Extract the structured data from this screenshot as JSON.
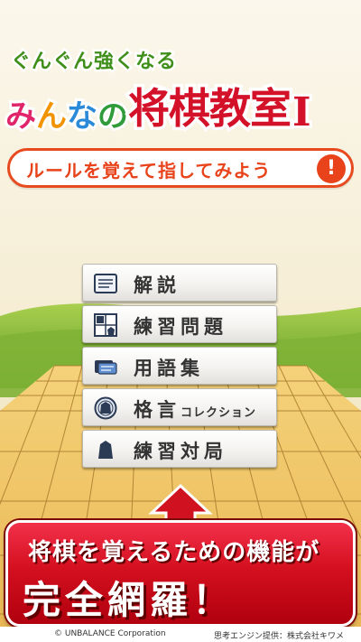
{
  "app": {
    "subtitle": "ぐんぐん強くなる",
    "title_kana": [
      "み",
      "ん",
      "な",
      "の"
    ],
    "title_kanji": "将棋教室",
    "title_numeral": "I",
    "banner": "ルールを覚えて指してみよう",
    "banner_mark": "!"
  },
  "menu": {
    "items": [
      {
        "label": "解説",
        "icon": "book-icon"
      },
      {
        "label": "練習問題",
        "icon": "board-puzzle-icon"
      },
      {
        "label": "用語集",
        "icon": "glossary-card-icon"
      },
      {
        "label_main": "格言",
        "label_small": "コレクション",
        "icon": "shogi-piece-medal-icon"
      },
      {
        "label": "練習対局",
        "icon": "shogi-piece-icon"
      }
    ]
  },
  "promo": {
    "line1": "将棋を覚えるための機能が",
    "line2": "完全網羅！"
  },
  "footer": {
    "copyright": "© UNBALANCE Corporation",
    "engine_credit": "思考エンジン提供：株式会社キワメ"
  },
  "colors": {
    "title_red": "#d3122a",
    "subtitle_green": "#3f8f1a",
    "banner_orange": "#e8431a",
    "promo_red": "#d4101f"
  }
}
